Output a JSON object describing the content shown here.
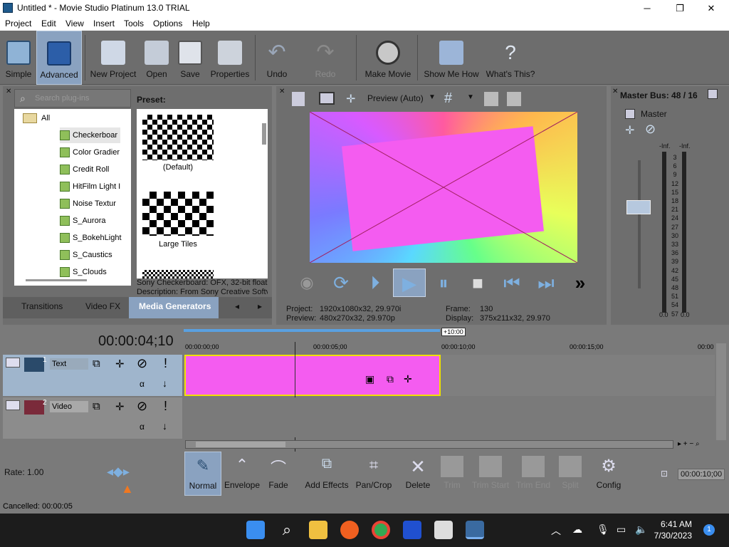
{
  "window": {
    "title": "Untitled * - Movie Studio Platinum 13.0 TRIAL",
    "min": "─",
    "max": "❐",
    "close": "✕"
  },
  "menu": [
    "Project",
    "Edit",
    "View",
    "Insert",
    "Tools",
    "Options",
    "Help"
  ],
  "toolbar": {
    "simple": "Simple",
    "advanced": "Advanced",
    "new_project": "New Project",
    "open": "Open",
    "save": "Save",
    "properties": "Properties",
    "undo": "Undo",
    "redo": "Redo",
    "make_movie": "Make Movie",
    "show_me_how": "Show Me How",
    "whats_this": "What's This?"
  },
  "plugins": {
    "search_placeholder": "Search plug-ins",
    "items": [
      "All",
      "Checkerboar",
      "Color Gradier",
      "Credit Roll",
      "HitFilm Light I",
      "Noise Textur",
      "S_Aurora",
      "S_BokehLight",
      "S_Caustics",
      "S_Clouds"
    ],
    "preset_label": "Preset:",
    "presets": [
      "(Default)",
      "Large Tiles"
    ],
    "desc_line1": "Sony Checkerboard: OFX, 32-bit floati",
    "desc_line2": "Description: From Sony Creative Softv",
    "tabs": [
      "Transitions",
      "Video FX",
      "Media Generators"
    ],
    "tab_prev": "◂",
    "tab_next": "▸"
  },
  "preview": {
    "mode": "Preview (Auto)",
    "project_label": "Project:",
    "project_value": "1920x1080x32, 29.970i",
    "preview_label": "Preview:",
    "preview_value": "480x270x32, 29.970p",
    "frame_label": "Frame:",
    "frame_value": "130",
    "display_label": "Display:",
    "display_value": "375x211x32, 29.970"
  },
  "mixer": {
    "title": "Master Bus: 48 / 16",
    "master": "Master",
    "inf_left": "-Inf.",
    "inf_right": "-Inf.",
    "scale": [
      "3",
      "6",
      "9",
      "12",
      "15",
      "18",
      "21",
      "24",
      "27",
      "30",
      "33",
      "36",
      "39",
      "42",
      "45",
      "48",
      "51",
      "54",
      "57"
    ],
    "bottom_left": "0.0",
    "bottom_right": "0.0"
  },
  "timeline": {
    "timecode": "00:00:04;10",
    "offset": "+10:00",
    "ruler": [
      "00:00:00;00",
      "00:00:05;00",
      "00:00:10;00",
      "00:00:15;00",
      "00:00"
    ],
    "tracks": [
      {
        "num": "1",
        "name": "Text"
      },
      {
        "num": "2",
        "name": "Video"
      }
    ],
    "rate_label": "Rate: 1.00",
    "end_time": "00:00:10;00"
  },
  "edit_tools": {
    "normal": "Normal",
    "envelope": "Envelope",
    "fade": "Fade",
    "add_effects": "Add Effects",
    "pan_crop": "Pan/Crop",
    "delete": "Delete",
    "trim": "Trim",
    "trim_start": "Trim Start",
    "trim_end": "Trim End",
    "split": "Split",
    "config": "Config"
  },
  "status": "Cancelled: 00:00:05",
  "taskbar": {
    "time": "6:41 AM",
    "date": "7/30/2023",
    "badge": "1"
  },
  "colors": {
    "clip_fill": "#f45cf0",
    "clip_border": "#f0e000",
    "selected_tab": "#8aa2c0"
  }
}
